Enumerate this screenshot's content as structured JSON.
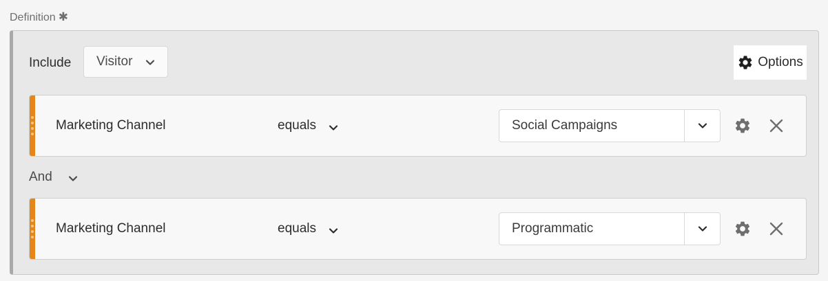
{
  "definition": {
    "label": "Definition",
    "required_mark": "✱"
  },
  "container": {
    "include_label": "Include",
    "scope": "Visitor",
    "options_label": "Options"
  },
  "rules": [
    {
      "dimension": "Marketing Channel",
      "operator": "equals",
      "value": "Social Campaigns"
    },
    {
      "dimension": "Marketing Channel",
      "operator": "equals",
      "value": "Programmatic"
    }
  ],
  "logic_operator": "And",
  "icons": {
    "chevron": "chevron-down-icon",
    "gear": "gear-icon",
    "close": "close-icon",
    "drag": "drag-handle-icon"
  },
  "colors": {
    "accent": "#e68619",
    "container_border": "#a9a9a9"
  }
}
